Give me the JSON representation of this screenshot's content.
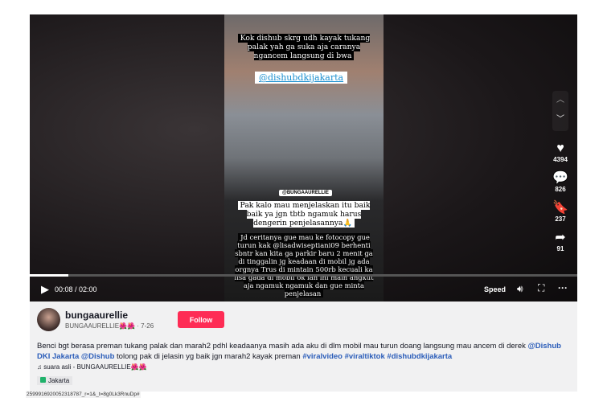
{
  "video": {
    "caption_top": "Kok dishub skrg udh kayak tukang palak yah ga suka aja caranya ngancem langsung di bwa",
    "mention_tag": "@dishubdkijakarta",
    "watermark_tag": "@BUNGAAURELLIE",
    "caption_middle": "Pak kalo mau menjelaskan itu baik baik ya jgn tbtb ngamuk harus dengerin penjelasannya🙏",
    "caption_bottom": "Jd ceritanya gue mau ke fotocopy gue turun kak @lisadwiseptiani09 berhenti sbntr kan kita ga parkir baru 2 menit ga di tinggalin jg keadaan di mobil jg ada orgnya Trus di mintain 500rb kecuali ka lisa gada di mobil ok lah ini main angkut aja ngamuk ngamuk dan gue minta penjelasan"
  },
  "controls": {
    "time": "00:08 / 02:00",
    "progress": 0.07,
    "speed_label": "Speed"
  },
  "actions": {
    "likes": "4394",
    "comments": "826",
    "saves": "237",
    "shares": "91"
  },
  "author": {
    "username": "bungaaurellie",
    "nickname": "BUNGAAURELLIE🌺🌺",
    "date": "· 7-26",
    "follow_label": "Follow"
  },
  "description": {
    "text": "Benci bgt berasa preman tukang palak dan marah2 pdhl keadaanya masih ada aku di dlm mobil mau turun doang langsung mau ancem di derek ",
    "mention1": "@Dishub DKI Jakarta",
    "mention2": "@Dishub",
    "text2": " tolong pak di jelasin yg baik jgn marah2 kayak preman ",
    "hashtags": [
      "#viralvideo",
      "#viraltiktok",
      "#dishubdkijakarta"
    ]
  },
  "music": "♫ suara asli - BUNGAAURELLIE🌺🌺",
  "location": "Jakarta",
  "status_url": "2599916920052318787_r=1&_t=8g0Lk3RnuDp#"
}
